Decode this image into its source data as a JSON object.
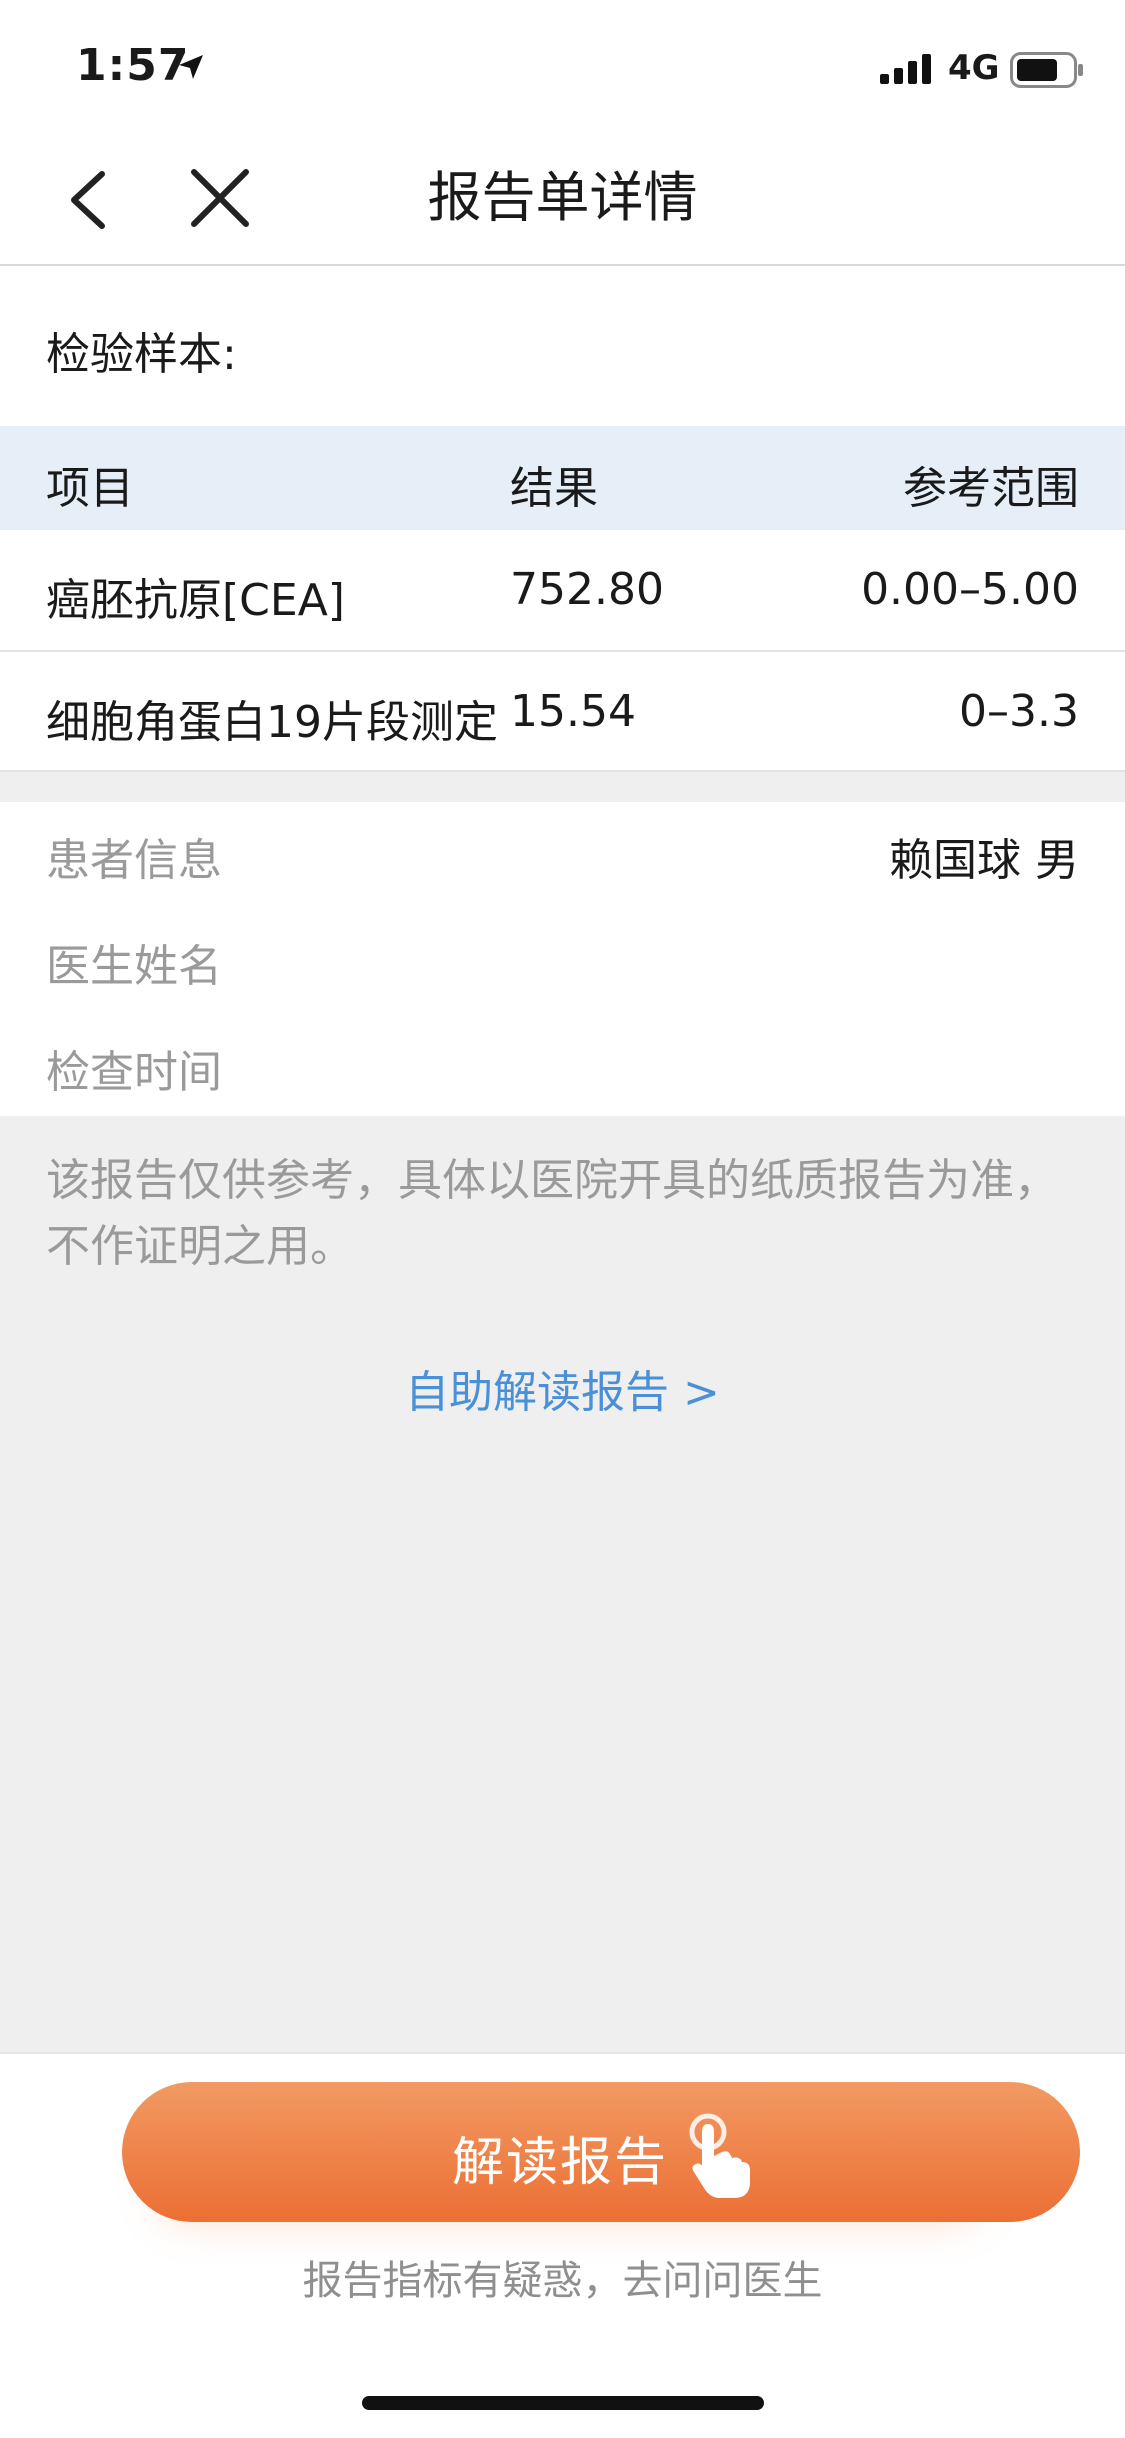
{
  "status_bar": {
    "time": "1:57",
    "network": "4G"
  },
  "nav": {
    "title": "报告单详情"
  },
  "sample": {
    "label": "检验样本:"
  },
  "table": {
    "headers": {
      "item": "项目",
      "result": "结果",
      "reference": "参考范围"
    },
    "rows": [
      {
        "item": "癌胚抗原[CEA]",
        "result": "752.80",
        "reference": "0.00–5.00"
      },
      {
        "item": "细胞角蛋白19片段测定",
        "result": "15.54",
        "reference": "0–3.3"
      }
    ]
  },
  "info": {
    "patient_label": "患者信息",
    "patient_value": "赖国球   男",
    "doctor_label": "医生姓名",
    "time_label": "检查时间"
  },
  "disclaimer": "该报告仅供参考，具体以医院开具的纸质报告为准，不作证明之用。",
  "self_read_link": "自助解读报告 >",
  "cta": {
    "label": "解读报告",
    "subtext": "报告指标有疑惑，去问问医生"
  },
  "colors": {
    "accent_orange": "#ec6f34",
    "link_blue": "#4a90d9",
    "table_header_bg": "#e6eef8"
  }
}
